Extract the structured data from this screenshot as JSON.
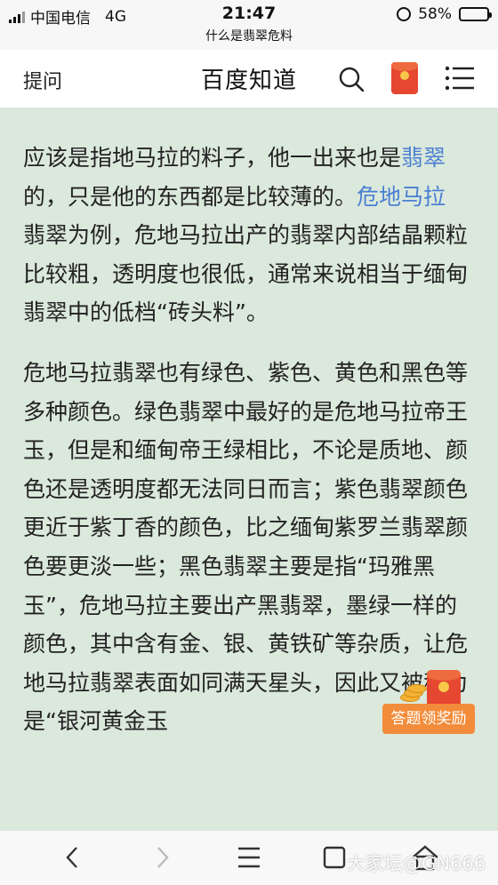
{
  "status_bar": {
    "carrier": "中国电信",
    "network": "4G",
    "time": "21:47",
    "battery": "58%",
    "battery_level": 0.58,
    "page_title": "什么是翡翠危料"
  },
  "nav": {
    "ask_label": "提问",
    "title": "百度知道",
    "icons": [
      "search-icon",
      "red-packet-icon",
      "menu-icon"
    ]
  },
  "article": {
    "p1": {
      "t1": "应该是指地马拉的料子，他一出来也是",
      "link1": "翡翠",
      "t2": "的，只是他的东西都是比较薄的。",
      "link2": "危地马拉",
      "t3": "翡翠为例，危地马拉出产的翡翠内部结晶颗粒比较粗，透明度也很低，通常来说相当于缅甸翡翠中的低档“砖头料”。"
    },
    "p2": "危地马拉翡翠也有绿色、紫色、黄色和黑色等多种颜色。绿色翡翠中最好的是危地马拉帝王玉，但是和缅甸帝王绿相比，不论是质地、颜色还是透明度都无法同日而言；紫色翡翠颜色更近于紫丁香的颜色，比之缅甸紫罗兰翡翠颜色要更淡一些；黑色翡翠主要是指“玛雅黑玉”，危地马拉主要出产黑翡翠，墨绿一样的颜色，其中含有金、银、黄铁矿等杂质，让危地马拉翡翠表面如同满天星头，因此又被称为是“银河黄金玉"
  },
  "reward": {
    "label": "答题领奖励"
  },
  "bottom_bar": {
    "icons": [
      "back-icon",
      "forward-icon",
      "menu-icon",
      "tabs-icon",
      "home-icon"
    ]
  },
  "watermark": "大家坛@GN666",
  "colors": {
    "background": "#dbe8dc",
    "link": "#4a7fd1",
    "reward": "#f38c3a",
    "red_packet": "#e54730"
  }
}
